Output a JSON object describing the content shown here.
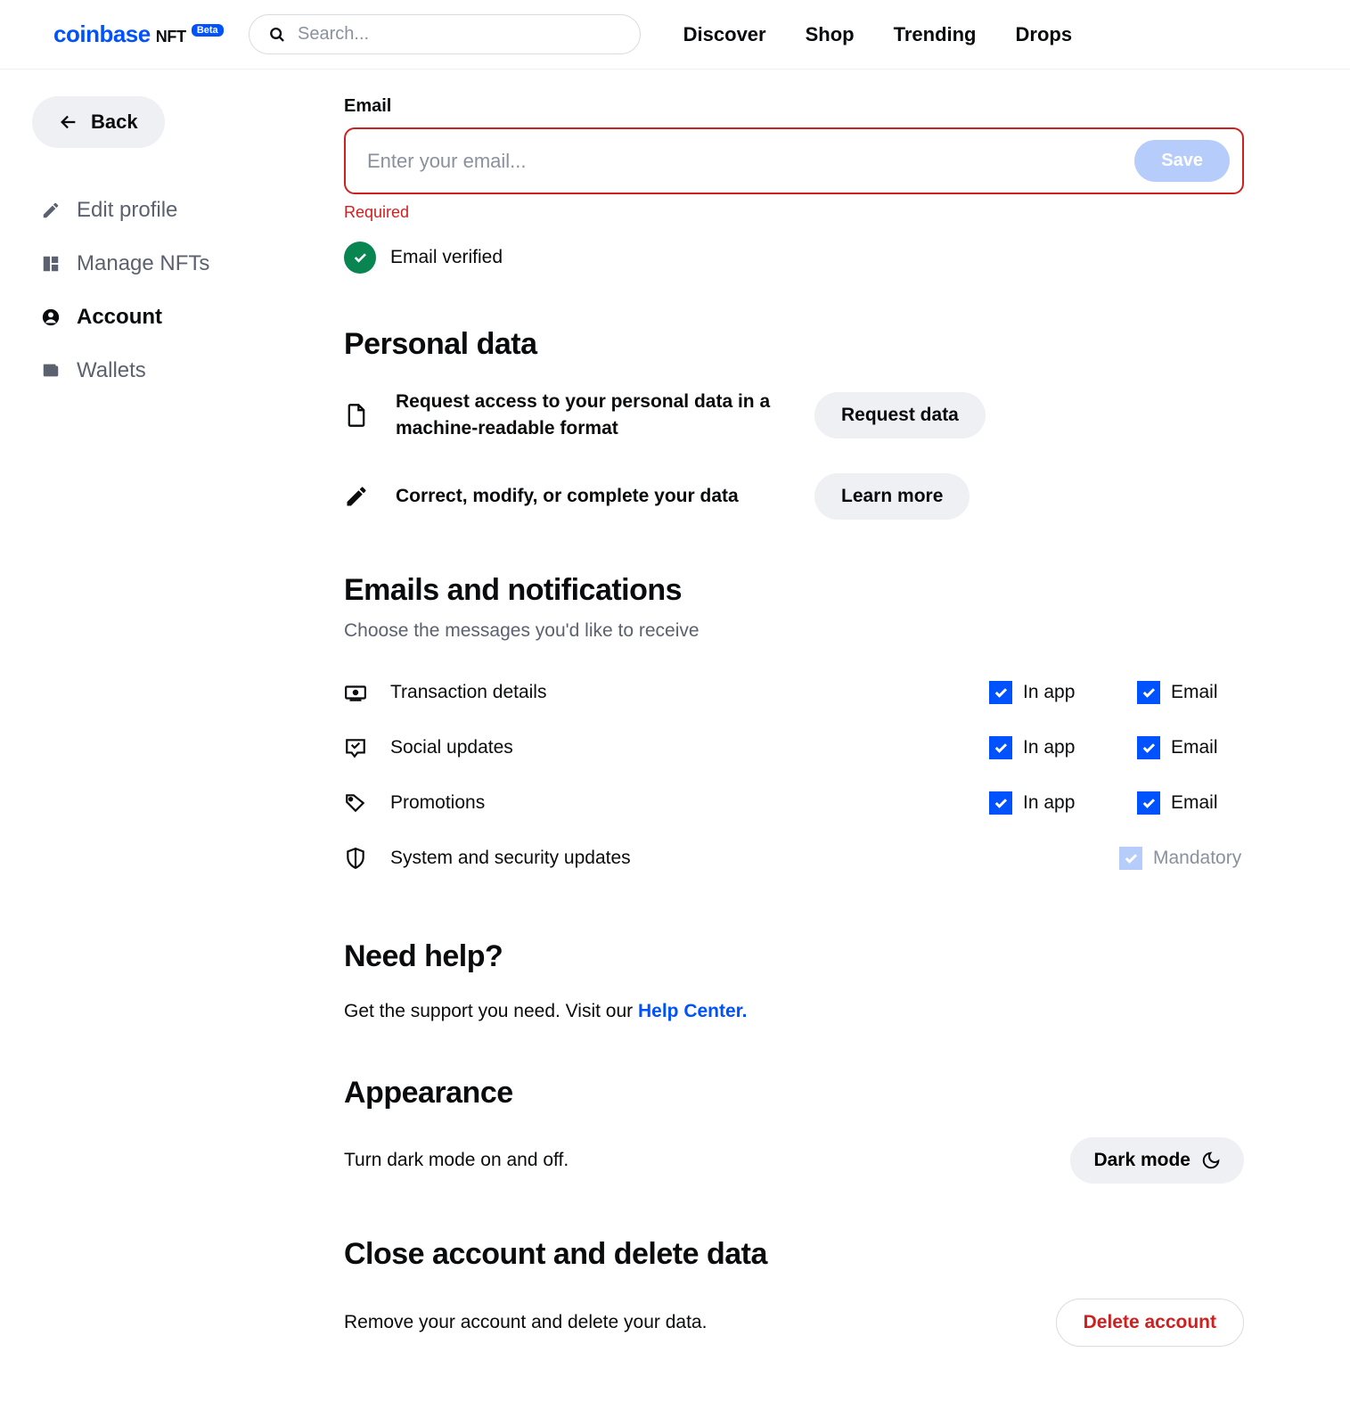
{
  "header": {
    "logo_main": "coinbase",
    "logo_nft": "NFT",
    "beta": "Beta",
    "search_placeholder": "Search...",
    "nav": [
      "Discover",
      "Shop",
      "Trending",
      "Drops"
    ]
  },
  "sidebar": {
    "back": "Back",
    "items": [
      {
        "label": "Edit profile",
        "active": false
      },
      {
        "label": "Manage NFTs",
        "active": false
      },
      {
        "label": "Account",
        "active": true
      },
      {
        "label": "Wallets",
        "active": false
      }
    ]
  },
  "email": {
    "label": "Email",
    "placeholder": "Enter your email...",
    "save": "Save",
    "error": "Required",
    "verified": "Email verified"
  },
  "personal_data": {
    "title": "Personal data",
    "row1_text": "Request access to your personal data in a machine-readable format",
    "row1_btn": "Request data",
    "row2_text": "Correct, modify, or complete your data",
    "row2_btn": "Learn more"
  },
  "notifications": {
    "title": "Emails and notifications",
    "subtitle": "Choose the messages you'd like to receive",
    "inapp_label": "In app",
    "email_label": "Email",
    "mandatory_label": "Mandatory",
    "rows": [
      {
        "label": "Transaction details"
      },
      {
        "label": "Social updates"
      },
      {
        "label": "Promotions"
      },
      {
        "label": "System and security updates"
      }
    ]
  },
  "help": {
    "title": "Need help?",
    "text": "Get the support you need. Visit our ",
    "link": "Help Center."
  },
  "appearance": {
    "title": "Appearance",
    "text": "Turn dark mode on and off.",
    "btn": "Dark mode"
  },
  "close": {
    "title": "Close account and delete data",
    "text": "Remove your account and delete your data.",
    "btn": "Delete account"
  }
}
